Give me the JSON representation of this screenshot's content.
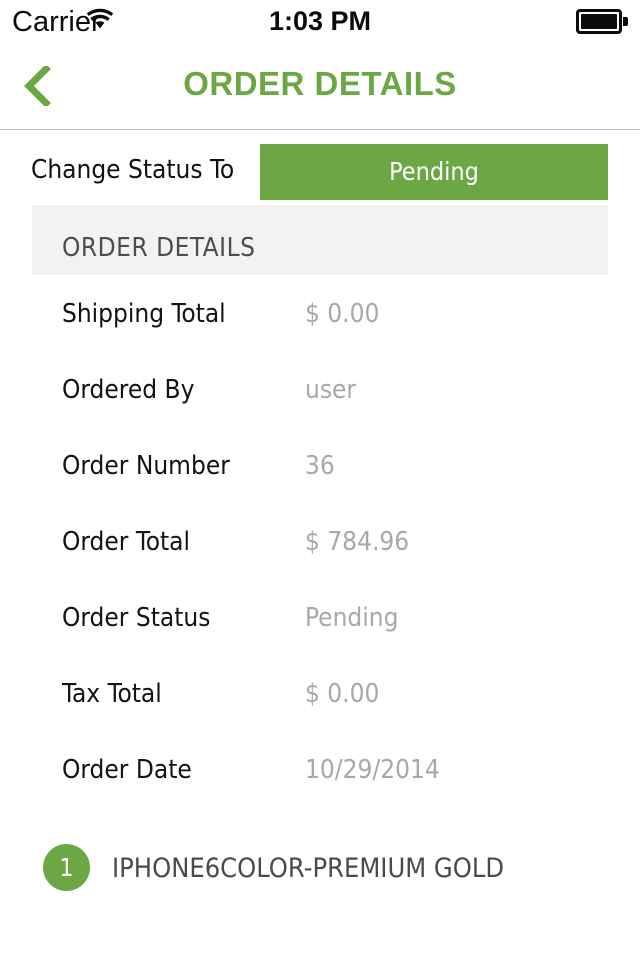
{
  "status_bar": {
    "carrier": "Carrier",
    "wifi_icon": "wifi-icon",
    "time": "1:03 PM",
    "battery_icon": "battery-full-icon"
  },
  "nav_bar": {
    "back_icon": "chevron-left-icon",
    "title": "ORDER DETAILS",
    "accent_color": "#6ba843"
  },
  "change_status": {
    "label": "Change Status To",
    "button_label": "Pending",
    "button_color": "#6ba843"
  },
  "section": {
    "header": "ORDER DETAILS",
    "header_bg": "#f2f2f2"
  },
  "details": [
    {
      "label": "Shipping Total",
      "value": "$ 0.00"
    },
    {
      "label": "Ordered By",
      "value": "user"
    },
    {
      "label": "Order Number",
      "value": "36"
    },
    {
      "label": "Order Total",
      "value": "$ 784.96"
    },
    {
      "label": "Order Status",
      "value": "Pending"
    },
    {
      "label": "Tax Total",
      "value": "$ 0.00"
    },
    {
      "label": "Order Date",
      "value": "10/29/2014"
    }
  ],
  "line_items": [
    {
      "qty": "1",
      "name": "IPHONE6COLOR-PREMIUM GOLD"
    }
  ]
}
